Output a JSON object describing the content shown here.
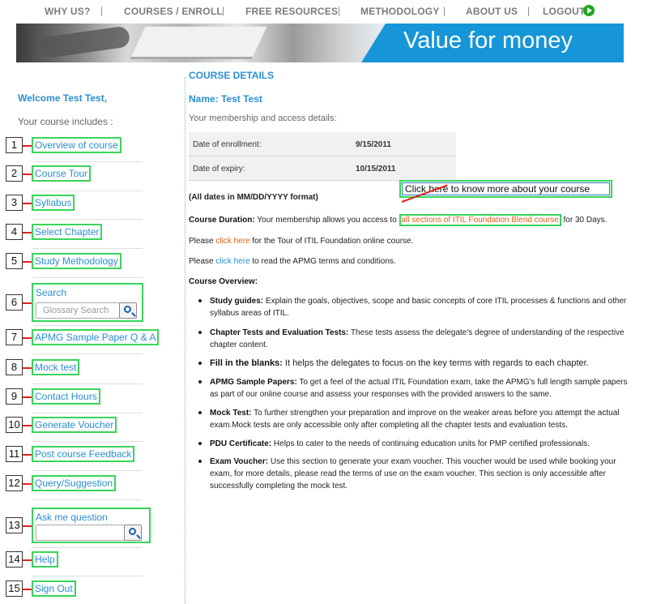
{
  "nav": {
    "items": [
      "WHY US?",
      "COURSES / ENROLL",
      "FREE RESOURCES",
      "METHODOLOGY",
      "ABOUT US",
      "LOGOUT"
    ],
    "separator": "|"
  },
  "banner": {
    "tagline": "Value for money"
  },
  "sidebar": {
    "welcome": "Welcome Test Test,",
    "includes": "Your course includes :",
    "numbers": [
      "1",
      "2",
      "3",
      "4",
      "5",
      "6",
      "7",
      "8",
      "9",
      "10",
      "11",
      "12",
      "13",
      "14",
      "15"
    ],
    "items": [
      "Overview of course",
      "Course Tour",
      "Syllabus",
      "Select Chapter",
      "Study Methodology",
      "Search",
      "APMG Sample Paper Q & A",
      "Mock test",
      "Contact Hours",
      "Generate Voucher",
      "Post course Feedback",
      "Query/Suggestion",
      "Ask me question",
      "Help",
      "Sign Out"
    ],
    "search_placeholder": "Glossary Search",
    "ask_placeholder": ""
  },
  "main": {
    "heading": "COURSE DETAILS",
    "name": "Name: Test Test",
    "access_text": "Your membership and access details:",
    "details": [
      {
        "label": "Date of enrollment:",
        "value": "9/15/2011"
      },
      {
        "label": "Date of expiry:",
        "value": "10/15/2011"
      }
    ],
    "dates_note": "(All dates in MM/DD/YYYY format)",
    "callout": "Click here to know more about your course",
    "duration_label": "Course Duration:",
    "duration_pre": " Your membership allows you access to ",
    "duration_link": "all sections of ITIL Foundation Blend course",
    "duration_post": " for 30 Days.",
    "tour_pre": "Please ",
    "tour_link": "click here",
    "tour_post": " for the Tour of ITIL Foundation online course.",
    "terms_pre": "Please ",
    "terms_link": "click here",
    "terms_post": " to read the APMG terms and conditions.",
    "overview_heading": "Course Overview:",
    "overview": [
      {
        "title": "Study guides:",
        "text": " Explain the goals, objectives, scope and basic concepts of core ITIL processes & functions and other syllabus areas of ITIL."
      },
      {
        "title": "Chapter Tests and Evaluation Tests:",
        "text": " These tests assess the delegate's degree of understanding of the respective chapter content."
      },
      {
        "title": "Fill in the blanks:",
        "text": " It helps the delegates to focus on the key terms with regards to each chapter."
      },
      {
        "title": "APMG Sample Papers:",
        "text": " To get a feel of the actual ITIL Foundation exam, take the APMG's full length sample papers as part of our online course and assess your responses with the provided answers to the same."
      },
      {
        "title": "Mock Test:",
        "text": " To further strengthen your preparation and improve on the weaker areas before you attempt the actual exam.Mock tests are only accessible only after completing all the chapter tests and evaluation tests."
      },
      {
        "title": "PDU Certificate:",
        "text": " Helps to cater to the needs of continuing education units for PMP certified professionals."
      },
      {
        "title": "Exam Voucher:",
        "text": " Use this section to generate your exam voucher. This voucher would be used while booking your exam, for more details, please read the terms of use on the exam voucher. This section is only accessible after successfully completing the mock test."
      }
    ]
  }
}
